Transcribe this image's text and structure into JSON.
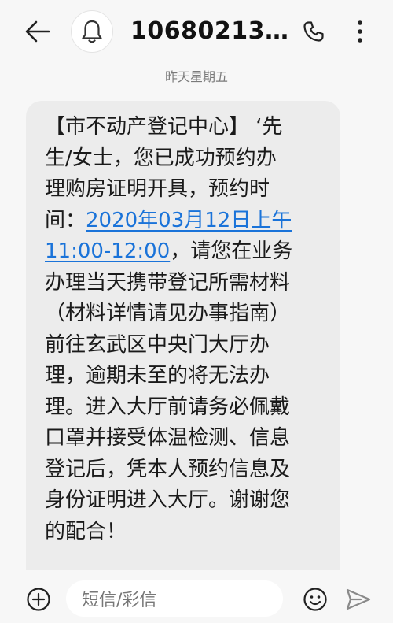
{
  "header": {
    "contact_name": "10680213…",
    "icons": {
      "back": "arrow-left-icon",
      "avatar": "bell-icon",
      "call": "phone-icon",
      "more": "more-vertical-icon"
    }
  },
  "date_label": "昨天星期五",
  "message": {
    "lines": [
      {
        "text": "【市不动产登记中心】  ‘先"
      },
      {
        "text": "生/女士，您已成功预约办"
      },
      {
        "text": "理购房证明开具，预约时"
      },
      {
        "before": "间：",
        "link": "2020年03月12日上午",
        "after": ""
      },
      {
        "before": "",
        "link": "11:00-12:00",
        "after": "，请您在业务"
      },
      {
        "text": "办理当天携带登记所需材料"
      },
      {
        "text": "（材料详情请见办事指南）"
      },
      {
        "text": "前往玄武区中央门大厅办"
      },
      {
        "text": "理，逾期未至的将无法办"
      },
      {
        "text": "理。进入大厅前请务必佩戴"
      },
      {
        "text": "口罩并接受体温检测、信息"
      },
      {
        "text": "登记后，凭本人预约信息及"
      },
      {
        "text": "身份证明进入大厅。谢谢您"
      },
      {
        "text": "的配合！"
      }
    ],
    "link_color": "#1a73d9",
    "bubble_color": "#ececec"
  },
  "input_bar": {
    "placeholder": "短信/彩信",
    "icons": {
      "add": "plus-circle-icon",
      "emoji": "smiley-icon",
      "send": "send-icon"
    }
  }
}
